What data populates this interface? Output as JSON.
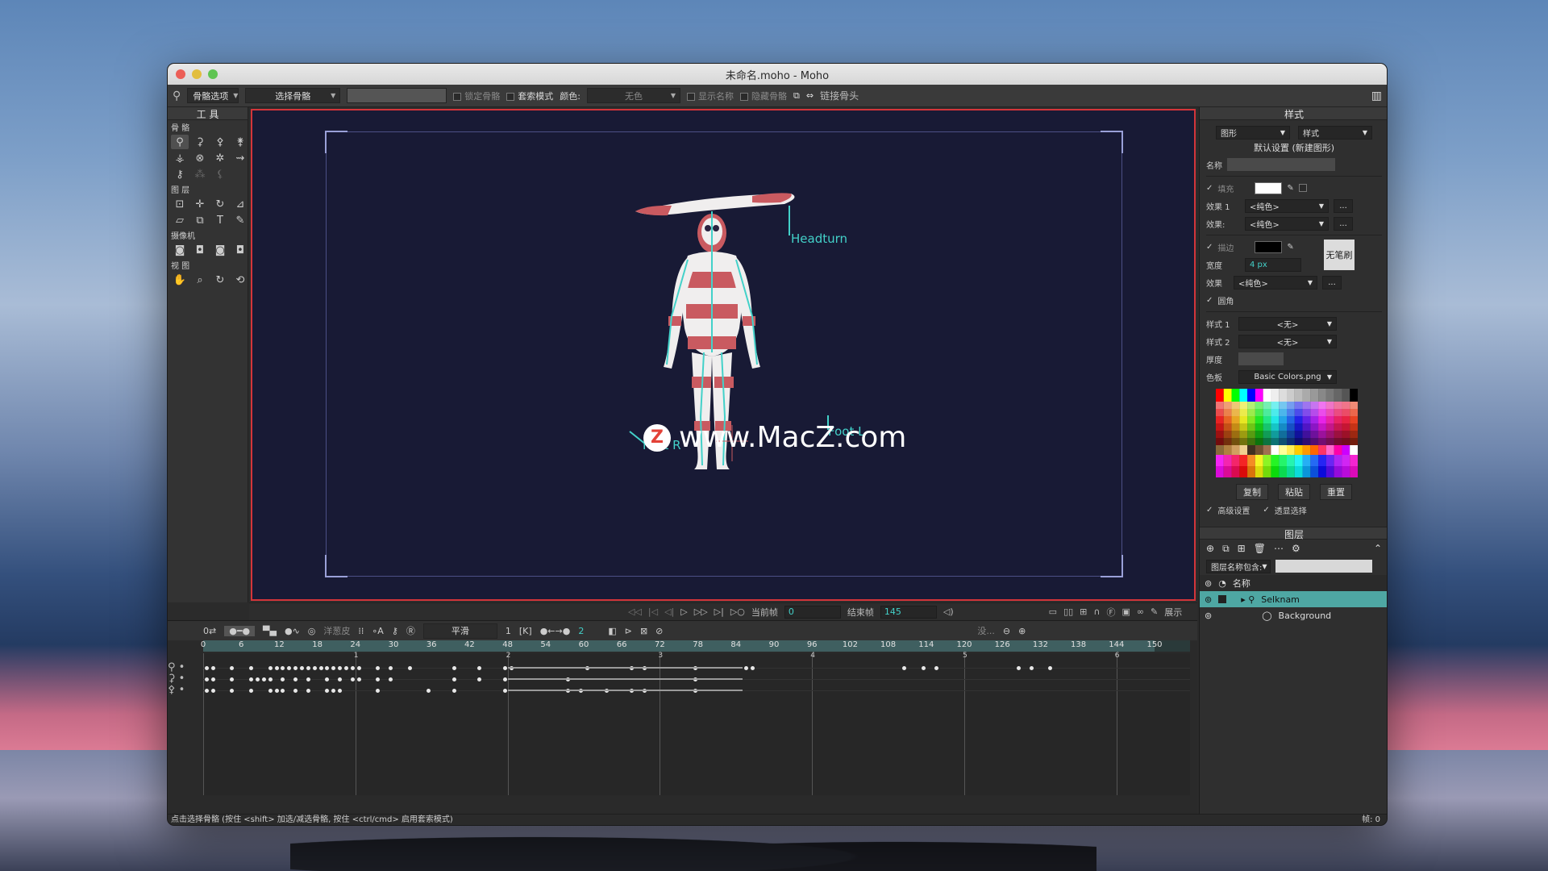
{
  "window": {
    "title": "未命名.moho - Moho"
  },
  "toolbar": {
    "bone_options": "骨骼选项",
    "select_bone": "选择骨骼",
    "lock_bone": "锁定骨骼",
    "lasso_mode": "套索模式",
    "color_label": "颜色:",
    "color_value": "无色",
    "show_names": "显示名称",
    "hide_bones": "隐藏骨骼",
    "link_bones": "链接骨头"
  },
  "tools": {
    "title": "工 具",
    "sections": {
      "bone": "骨 骼",
      "layer": "图 层",
      "camera": "摄像机",
      "view": "视 图"
    }
  },
  "stage": {
    "labels": {
      "headturn": "Headturn",
      "foot_r": "Foot R",
      "foot_l": "Foot L"
    },
    "watermark": "www.MacZ.com",
    "watermark_logo": "Z"
  },
  "transport": {
    "current_frame_label": "当前帧",
    "current_frame": "0",
    "end_frame_label": "结束帧",
    "end_frame": "145",
    "display": "展示"
  },
  "timeline": {
    "onion": "洋葱皮",
    "interp": "平滑",
    "step": "1",
    "keys_count": "2",
    "filter": "没...",
    "ticks": [
      "0",
      "6",
      "12",
      "18",
      "24",
      "30",
      "36",
      "42",
      "48",
      "54",
      "60",
      "66",
      "72",
      "78",
      "84",
      "90",
      "96",
      "102",
      "108",
      "114",
      "120",
      "126",
      "132",
      "138",
      "144",
      "150"
    ],
    "seconds": [
      "1",
      "2",
      "3",
      "4",
      "5",
      "6"
    ]
  },
  "style_panel": {
    "title": "样式",
    "shape_dd": "图形",
    "style_dd": "样式",
    "default_label": "默认设置 (新建图形)",
    "name_label": "名称",
    "fill_label": "填充",
    "effect1_label": "效果 1",
    "effect2_label": "效果:",
    "effect_value": "<纯色>",
    "stroke_label": "描边",
    "width_label": "宽度",
    "width_value": "4 px",
    "effect3_label": "效果",
    "no_brush": "无笔刷",
    "round_label": "圆角",
    "style1_label": "样式 1",
    "style2_label": "样式 2",
    "none_value": "<无>",
    "thickness_label": "厚度",
    "palette_label": "色板",
    "palette_value": "Basic Colors.png",
    "copy": "复制",
    "paste": "粘贴",
    "reset": "重置",
    "advanced": "高级设置",
    "transparent_select": "透显选择",
    "fill_color": "#ffffff",
    "stroke_color": "#000000"
  },
  "layers_panel": {
    "title": "图层",
    "name_filter": "图层名称包含:",
    "name_col": "名称",
    "layers": [
      {
        "name": "Selknam",
        "selected": true
      },
      {
        "name": "Background",
        "selected": false
      }
    ]
  },
  "status": {
    "hint": "点击选择骨骼 (按住 <shift> 加选/减选骨骼, 按住 <ctrl/cmd> 启用套索模式)",
    "frame": "帧: 0"
  },
  "colors": {
    "accent": "#43d1c9",
    "stage_border": "#d3353a",
    "stage_bg": "#181a35"
  }
}
